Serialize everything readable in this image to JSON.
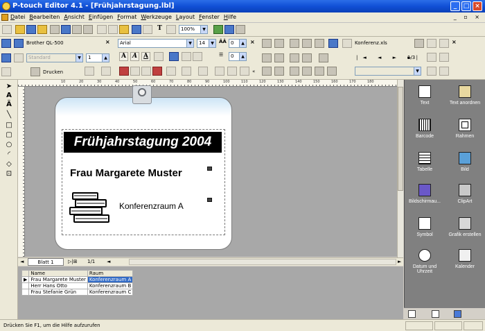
{
  "window": {
    "title": "P-touch Editor 4.1 - [Frühjahrstagung.lbl]"
  },
  "menu": [
    "Datei",
    "Bearbeiten",
    "Ansicht",
    "Einfügen",
    "Format",
    "Werkzeuge",
    "Layout",
    "Fenster",
    "Hilfe"
  ],
  "toolbar": {
    "zoom": "100%",
    "T_label": "T"
  },
  "printer_panel": {
    "printer": "Brother QL-500",
    "paper_style": "Standard",
    "copies": "1",
    "print_label": "Drucken"
  },
  "font_panel": {
    "font": "Arial",
    "size": "14",
    "spacing1": "0",
    "spacing2": "0",
    "btn_A1": "A",
    "btn_A2": "A",
    "btn_A3": "A"
  },
  "db_panel": {
    "file": "Konferenz.xls",
    "page": "1/3"
  },
  "label": {
    "headline": "Frühjahrstagung 2004",
    "name": "Frau Margarete Muster",
    "room": "Konferenzraum A"
  },
  "ruler_numbers": [
    "10",
    "20",
    "30",
    "40",
    "50",
    "60",
    "70",
    "80",
    "90",
    "100",
    "110",
    "120",
    "130",
    "140",
    "150",
    "160",
    "170",
    "180"
  ],
  "sheet": {
    "tab": "Blatt 1",
    "pager": "1/1"
  },
  "table": {
    "headers": [
      "Name",
      "Raum"
    ],
    "rows": [
      {
        "name": "Frau Margarete Muster",
        "room": "Konferenzraum A"
      },
      {
        "name": "Herr Hans Otto",
        "room": "Konferenzraum B"
      },
      {
        "name": "Frau Stefanie Grün",
        "room": "Konferenzraum C"
      }
    ]
  },
  "object_palette": [
    {
      "label": "Text",
      "icon": "text-icon"
    },
    {
      "label": "Text anordnen",
      "icon": "arrange-text-icon"
    },
    {
      "label": "Barcode",
      "icon": "barcode-icon"
    },
    {
      "label": "Rahmen",
      "icon": "frame-icon"
    },
    {
      "label": "Tabelle",
      "icon": "table-icon"
    },
    {
      "label": "Bild",
      "icon": "image-icon"
    },
    {
      "label": "Bildschirmau...",
      "icon": "screenshot-icon"
    },
    {
      "label": "ClipArt",
      "icon": "clipart-icon"
    },
    {
      "label": "Symbol",
      "icon": "symbol-icon"
    },
    {
      "label": "Grafik erstellen",
      "icon": "create-graphic-icon"
    },
    {
      "label": "Datum und Uhrzeit",
      "icon": "date-time-icon"
    },
    {
      "label": "Kalender",
      "icon": "calendar-icon"
    }
  ],
  "status": {
    "message": "Drücken Sie F1, um die Hilfe aufzurufen"
  }
}
